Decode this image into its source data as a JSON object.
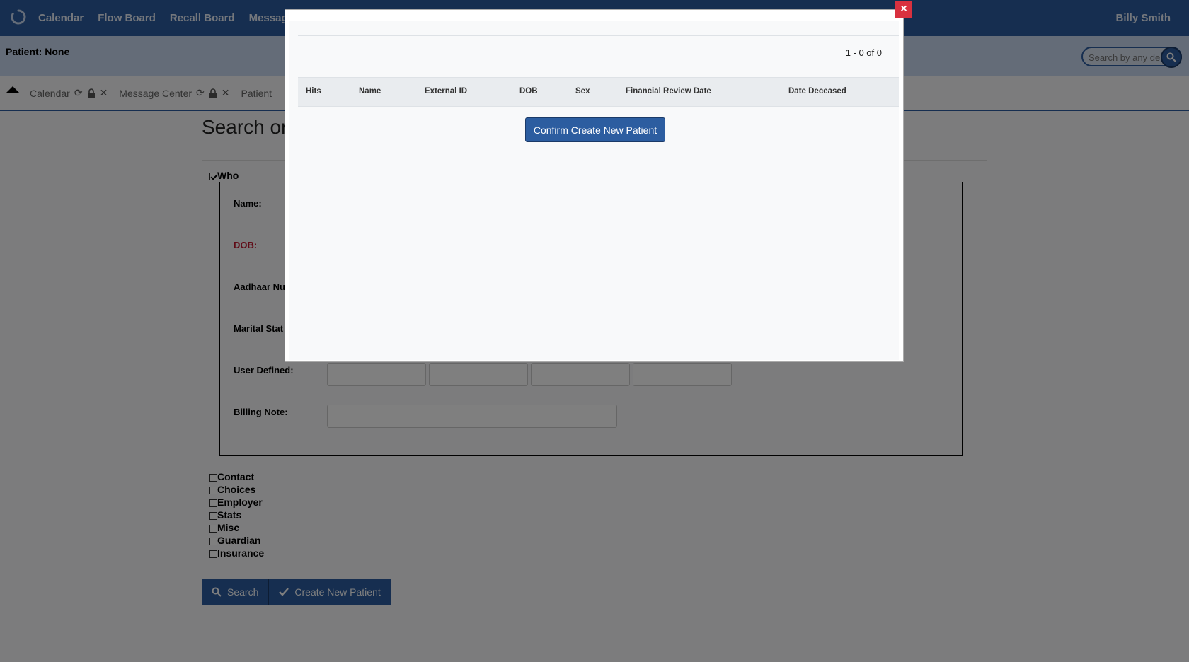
{
  "nav": {
    "logo_icon": "spinner-logo-icon",
    "items": [
      "Calendar",
      "Flow Board",
      "Recall Board",
      "Messages"
    ],
    "user": "Billy Smith"
  },
  "patient_bar": {
    "label": "Patient: None",
    "search_placeholder": "Search by any demographics",
    "search_icon": "magnifier-icon"
  },
  "tabs": [
    {
      "label": "Calendar"
    },
    {
      "label": "Message Center"
    },
    {
      "label": "Patient"
    }
  ],
  "page": {
    "title": "Search or"
  },
  "who": {
    "label": "Who",
    "checked": true,
    "fields": {
      "name": "Name:",
      "dob": "DOB:",
      "aadhaar": "Aadhaar Nu",
      "marital": "Marital Stat",
      "user_defined": "User Defined:",
      "billing_note": "Billing Note:"
    }
  },
  "options": [
    "Contact",
    "Choices",
    "Employer",
    "Stats",
    "Misc",
    "Guardian",
    "Insurance"
  ],
  "buttons": {
    "search": "Search",
    "create": "Create New Patient"
  },
  "modal": {
    "pager": "1 - 0 of 0",
    "columns": [
      "Hits",
      "Name",
      "External ID",
      "DOB",
      "Sex",
      "Financial Review Date",
      "Date Deceased"
    ],
    "confirm": "Confirm Create New Patient",
    "close": "×"
  },
  "colors": {
    "primary": "#2c5da0",
    "danger": "#d9313f",
    "dob_label": "#c0172e"
  }
}
